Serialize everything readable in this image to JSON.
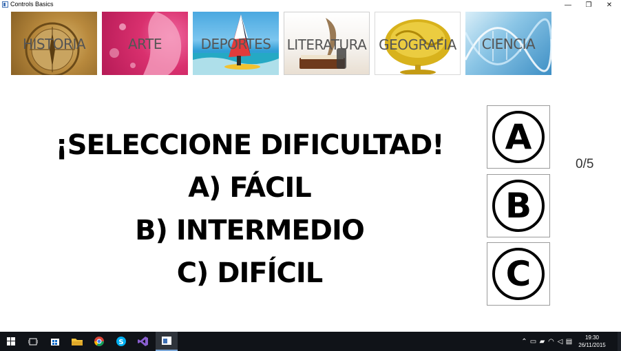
{
  "window": {
    "title": "Controls Basics",
    "minimize_glyph": "—",
    "maximize_glyph": "❐",
    "close_glyph": "✕"
  },
  "categories": [
    {
      "label": "HISTORIA",
      "icon": "compass-image"
    },
    {
      "label": "ARTE",
      "icon": "woman-silhouette-image"
    },
    {
      "label": "DEPORTES",
      "icon": "windsurf-image"
    },
    {
      "label": "LITERATURA",
      "icon": "quill-book-image"
    },
    {
      "label": "GEOGRAFIA",
      "icon": "golden-globe-image"
    },
    {
      "label": "CIENCIA",
      "icon": "dna-image"
    }
  ],
  "prompt": {
    "heading": "¡SELECCIONE DIFICULTAD!",
    "option_a": "A) FÁCIL",
    "option_b": "B) INTERMEDIO",
    "option_c": "C) DIFÍCIL"
  },
  "answer_buttons": {
    "a": "A",
    "b": "B",
    "c": "C"
  },
  "score": "0/5",
  "taskbar": {
    "clock_time": "19:30",
    "clock_date": "26/11/2015"
  }
}
